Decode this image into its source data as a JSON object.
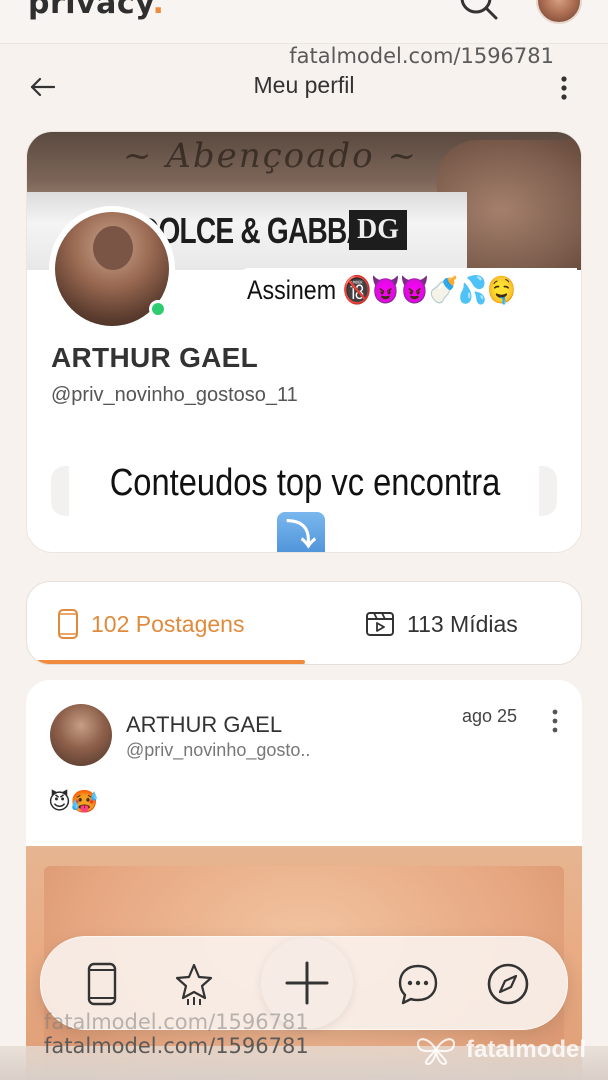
{
  "app": {
    "logo": "privacy",
    "logo_dot": "."
  },
  "watermark": {
    "text": "fatalmodel.com/1596781",
    "brand": "fatalmodel"
  },
  "header": {
    "title": "Meu perfil"
  },
  "profile": {
    "cover_brand": "DOLCE & GABBANA",
    "cover_logo": "DG",
    "bio_tag": "Assinem 🔞😈😈🍼💦🤤",
    "name": "ARTHUR GAEL",
    "handle": "@priv_novinho_gostoso_11",
    "cta_text": "Conteudos top vc encontra",
    "cta_arrow": "⤵"
  },
  "tabs": [
    {
      "label": "102 Postagens",
      "icon": "phone-icon",
      "active": true
    },
    {
      "label": "113 Mídias",
      "icon": "media-icon",
      "active": false
    }
  ],
  "post": {
    "author": "ARTHUR GAEL",
    "handle": "@priv_novinho_gosto..",
    "date": "ago 25",
    "text": "😈🥵"
  },
  "bottom_nav": [
    {
      "name": "home",
      "icon": "phone-icon"
    },
    {
      "name": "feed",
      "icon": "star-icon"
    },
    {
      "name": "add",
      "icon": "plus-icon"
    },
    {
      "name": "chat",
      "icon": "chat-icon"
    },
    {
      "name": "explore",
      "icon": "compass-icon"
    }
  ],
  "colors": {
    "accent": "#f08a3c",
    "online": "#2ecc71",
    "background": "#f7f2ee"
  }
}
